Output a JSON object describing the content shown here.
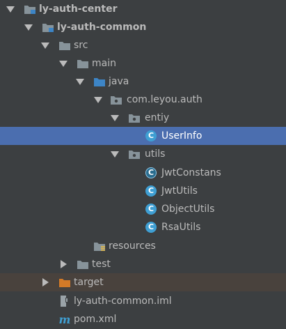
{
  "tree": {
    "root": {
      "label": "ly-auth-center",
      "icon": "module-folder-icon",
      "expanded": true
    },
    "module": {
      "label": "ly-auth-common",
      "icon": "module-folder-icon",
      "expanded": true
    },
    "src": {
      "label": "src",
      "icon": "folder-icon",
      "expanded": true
    },
    "main": {
      "label": "main",
      "icon": "folder-icon",
      "expanded": true
    },
    "java": {
      "label": "java",
      "icon": "source-root-folder-icon",
      "color": "#3d85c6",
      "expanded": true
    },
    "package": {
      "label": "com.leyou.auth",
      "icon": "package-icon",
      "expanded": true
    },
    "entiy": {
      "label": "entiy",
      "icon": "package-icon",
      "expanded": true
    },
    "userinfo": {
      "label": "UserInfo",
      "icon": "class-icon",
      "badge": "C",
      "selected": true
    },
    "utils": {
      "label": "utils",
      "icon": "package-icon",
      "expanded": true
    },
    "jwtconstans": {
      "label": "JwtConstans",
      "icon": "abstract-class-icon",
      "badge": "C"
    },
    "jwtutils": {
      "label": "JwtUtils",
      "icon": "class-icon",
      "badge": "C"
    },
    "objectutils": {
      "label": "ObjectUtils",
      "icon": "class-icon",
      "badge": "C"
    },
    "rsautils": {
      "label": "RsaUtils",
      "icon": "class-icon",
      "badge": "C"
    },
    "resources": {
      "label": "resources",
      "icon": "resources-folder-icon"
    },
    "test": {
      "label": "test",
      "icon": "folder-icon",
      "expanded": false
    },
    "target": {
      "label": "target",
      "icon": "excluded-folder-icon",
      "color": "#d47a27",
      "expanded": false
    },
    "iml": {
      "label": "ly-auth-common.iml",
      "icon": "iml-file-icon"
    },
    "pom": {
      "label": "pom.xml",
      "icon": "maven-icon",
      "badge": "m"
    }
  },
  "colors": {
    "background": "#3c3f41",
    "selection": "#4b6eaf",
    "excluded_row": "#49423d",
    "class_icon": "#3f9fd3",
    "folder": "#87939a"
  }
}
